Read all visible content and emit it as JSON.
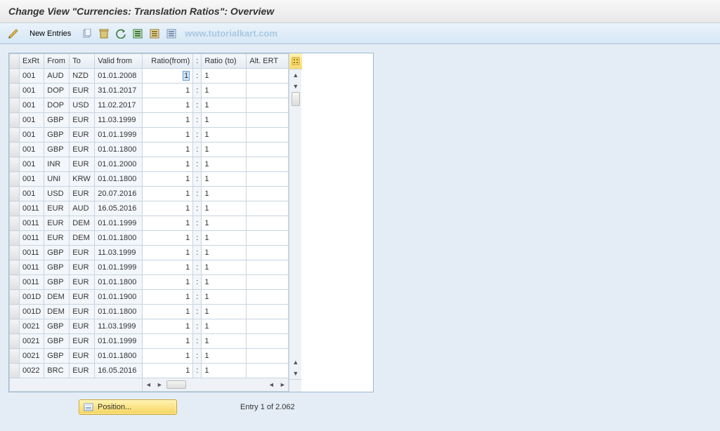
{
  "header": {
    "title": "Change View \"Currencies: Translation Ratios\": Overview"
  },
  "toolbar": {
    "new_entries_label": "New Entries",
    "watermark": "www.tutorialkart.com"
  },
  "columns": {
    "exrt": "ExRt",
    "from": "From",
    "to": "To",
    "valid": "Valid from",
    "rfrom": "Ratio(from)",
    "colon": ":",
    "rto": "Ratio (to)",
    "alt": "Alt. ERT"
  },
  "rows": [
    {
      "exrt": "001",
      "from": "AUD",
      "to": "NZD",
      "valid": "01.01.2008",
      "rfrom": "1",
      "rto": "1",
      "alt": "",
      "selected": true
    },
    {
      "exrt": "001",
      "from": "DOP",
      "to": "EUR",
      "valid": "31.01.2017",
      "rfrom": "1",
      "rto": "1",
      "alt": ""
    },
    {
      "exrt": "001",
      "from": "DOP",
      "to": "USD",
      "valid": "11.02.2017",
      "rfrom": "1",
      "rto": "1",
      "alt": ""
    },
    {
      "exrt": "001",
      "from": "GBP",
      "to": "EUR",
      "valid": "11.03.1999",
      "rfrom": "1",
      "rto": "1",
      "alt": ""
    },
    {
      "exrt": "001",
      "from": "GBP",
      "to": "EUR",
      "valid": "01.01.1999",
      "rfrom": "1",
      "rto": "1",
      "alt": ""
    },
    {
      "exrt": "001",
      "from": "GBP",
      "to": "EUR",
      "valid": "01.01.1800",
      "rfrom": "1",
      "rto": "1",
      "alt": ""
    },
    {
      "exrt": "001",
      "from": "INR",
      "to": "EUR",
      "valid": "01.01.2000",
      "rfrom": "1",
      "rto": "1",
      "alt": ""
    },
    {
      "exrt": "001",
      "from": "UNI",
      "to": "KRW",
      "valid": "01.01.1800",
      "rfrom": "1",
      "rto": "1",
      "alt": ""
    },
    {
      "exrt": "001",
      "from": "USD",
      "to": "EUR",
      "valid": "20.07.2016",
      "rfrom": "1",
      "rto": "1",
      "alt": ""
    },
    {
      "exrt": "0011",
      "from": "EUR",
      "to": "AUD",
      "valid": "16.05.2016",
      "rfrom": "1",
      "rto": "1",
      "alt": ""
    },
    {
      "exrt": "0011",
      "from": "EUR",
      "to": "DEM",
      "valid": "01.01.1999",
      "rfrom": "1",
      "rto": "1",
      "alt": ""
    },
    {
      "exrt": "0011",
      "from": "EUR",
      "to": "DEM",
      "valid": "01.01.1800",
      "rfrom": "1",
      "rto": "1",
      "alt": ""
    },
    {
      "exrt": "0011",
      "from": "GBP",
      "to": "EUR",
      "valid": "11.03.1999",
      "rfrom": "1",
      "rto": "1",
      "alt": ""
    },
    {
      "exrt": "0011",
      "from": "GBP",
      "to": "EUR",
      "valid": "01.01.1999",
      "rfrom": "1",
      "rto": "1",
      "alt": ""
    },
    {
      "exrt": "0011",
      "from": "GBP",
      "to": "EUR",
      "valid": "01.01.1800",
      "rfrom": "1",
      "rto": "1",
      "alt": ""
    },
    {
      "exrt": "001D",
      "from": "DEM",
      "to": "EUR",
      "valid": "01.01.1900",
      "rfrom": "1",
      "rto": "1",
      "alt": ""
    },
    {
      "exrt": "001D",
      "from": "DEM",
      "to": "EUR",
      "valid": "01.01.1800",
      "rfrom": "1",
      "rto": "1",
      "alt": ""
    },
    {
      "exrt": "0021",
      "from": "GBP",
      "to": "EUR",
      "valid": "11.03.1999",
      "rfrom": "1",
      "rto": "1",
      "alt": ""
    },
    {
      "exrt": "0021",
      "from": "GBP",
      "to": "EUR",
      "valid": "01.01.1999",
      "rfrom": "1",
      "rto": "1",
      "alt": ""
    },
    {
      "exrt": "0021",
      "from": "GBP",
      "to": "EUR",
      "valid": "01.01.1800",
      "rfrom": "1",
      "rto": "1",
      "alt": ""
    },
    {
      "exrt": "0022",
      "from": "BRC",
      "to": "EUR",
      "valid": "16.05.2016",
      "rfrom": "1",
      "rto": "1",
      "alt": ""
    }
  ],
  "footer": {
    "position_label": "Position...",
    "entry_text": "Entry 1 of 2.062"
  }
}
